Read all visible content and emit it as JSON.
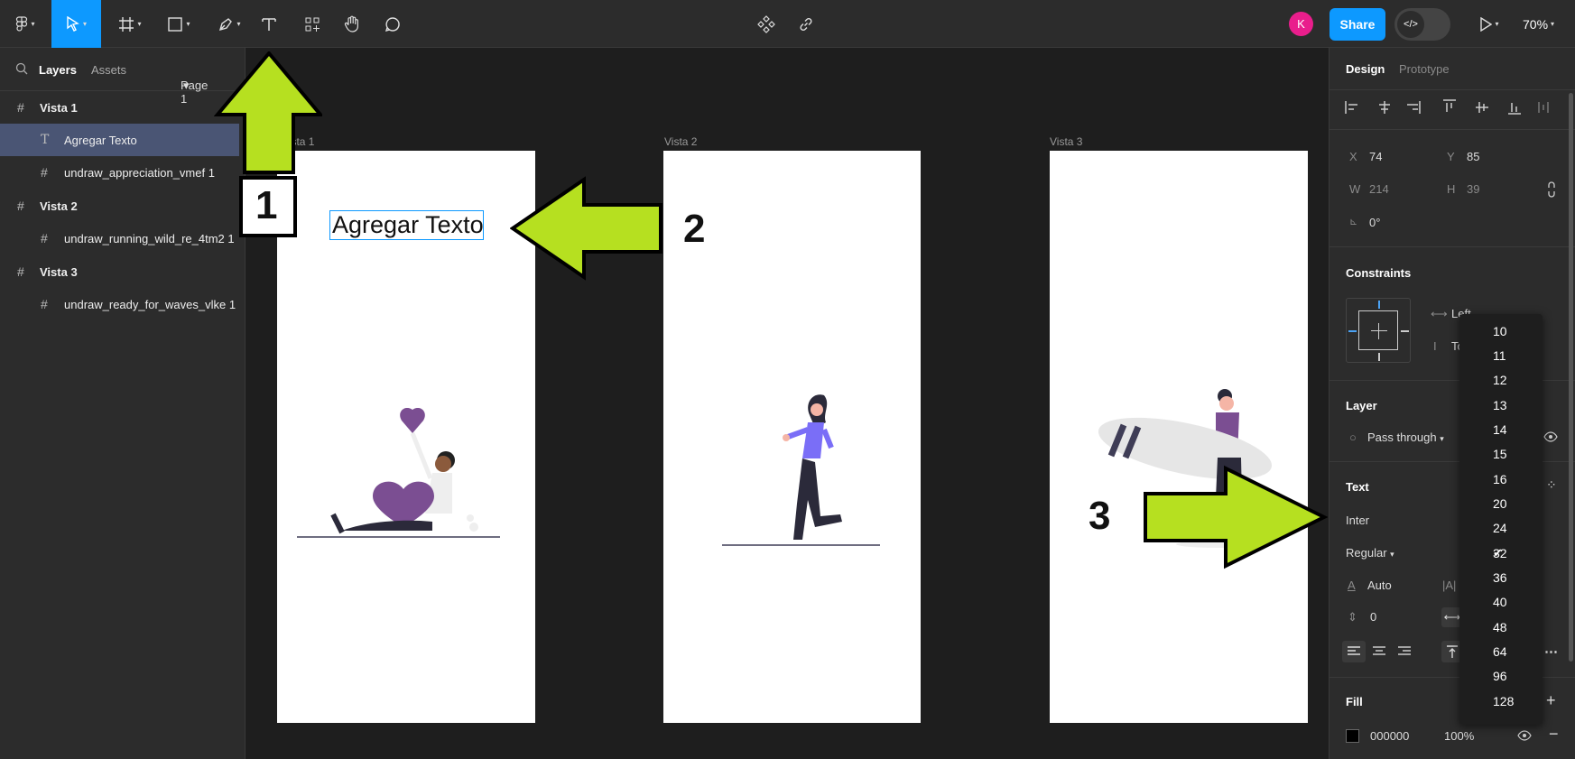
{
  "toolbar": {
    "share_label": "Share",
    "avatar_initial": "K",
    "zoom": "70%",
    "dev_mode_icon": "</>"
  },
  "left_panel": {
    "tab_layers": "Layers",
    "tab_assets": "Assets",
    "page_selector": "Page 1",
    "layers": [
      {
        "label": "Vista 1"
      },
      {
        "label": "Agregar Texto"
      },
      {
        "label": "undraw_appreciation_vmef 1"
      },
      {
        "label": "Vista 2"
      },
      {
        "label": "undraw_running_wild_re_4tm2 1"
      },
      {
        "label": "Vista 3"
      },
      {
        "label": "undraw_ready_for_waves_vlke 1"
      }
    ]
  },
  "canvas": {
    "frames": [
      {
        "label": "Vista 1"
      },
      {
        "label": "Vista 2"
      },
      {
        "label": "Vista 3"
      }
    ],
    "text_layer": "Agregar Texto",
    "annotations": [
      "1",
      "2",
      "3"
    ]
  },
  "right_panel": {
    "tab_design": "Design",
    "tab_prototype": "Prototype",
    "x_label": "X",
    "x_value": "74",
    "y_label": "Y",
    "y_value": "85",
    "w_label": "W",
    "w_value": "214",
    "h_label": "H",
    "h_value": "39",
    "rotation": "0°",
    "constraints_title": "Constraints",
    "constraint_h": "Left",
    "constraint_v": "Top",
    "layer_title": "Layer",
    "blend_mode": "Pass through",
    "text_title": "Text",
    "font_family": "Inter",
    "font_weight": "Regular",
    "line_height": "Auto",
    "letter_spacing": "0",
    "fill_title": "Fill",
    "fill_hex": "000000",
    "fill_opacity": "100%"
  },
  "font_size_dropdown": {
    "options": [
      "10",
      "11",
      "12",
      "13",
      "14",
      "15",
      "16",
      "20",
      "24",
      "32",
      "36",
      "40",
      "48",
      "64",
      "96",
      "128"
    ],
    "selected": "32"
  },
  "colors": {
    "accent": "#0d99ff",
    "arrow_green": "#b6e020",
    "selection": "#4a5574",
    "illustration_purple": "#7b4e92",
    "runner_shirt": "#7a6ef7"
  }
}
